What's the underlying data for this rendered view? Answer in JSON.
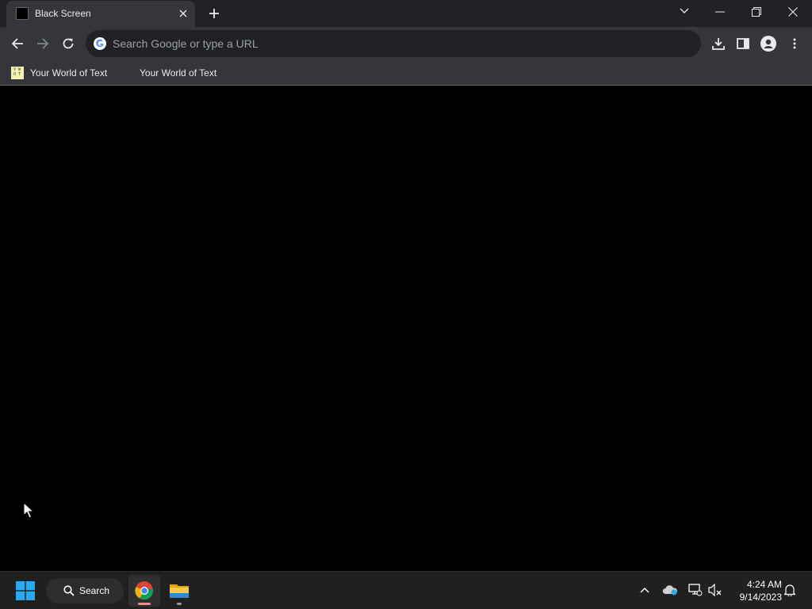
{
  "browser": {
    "tab": {
      "title": "Black Screen"
    },
    "omnibox": {
      "placeholder": "Search Google or type a URL"
    },
    "bookmarks": [
      {
        "label": "Your World of Text",
        "favicon": "ywot-icon"
      },
      {
        "label": "Your World of Text"
      }
    ],
    "page": {
      "background": "#000000"
    }
  },
  "taskbar": {
    "search_label": "Search",
    "clock": {
      "time": "4:24 AM",
      "date": "9/14/2023"
    }
  },
  "colors": {
    "tabstrip": "#202124",
    "toolbar": "#35363a",
    "taskbar": "#202020",
    "windows_accent": "#29a9f0"
  }
}
